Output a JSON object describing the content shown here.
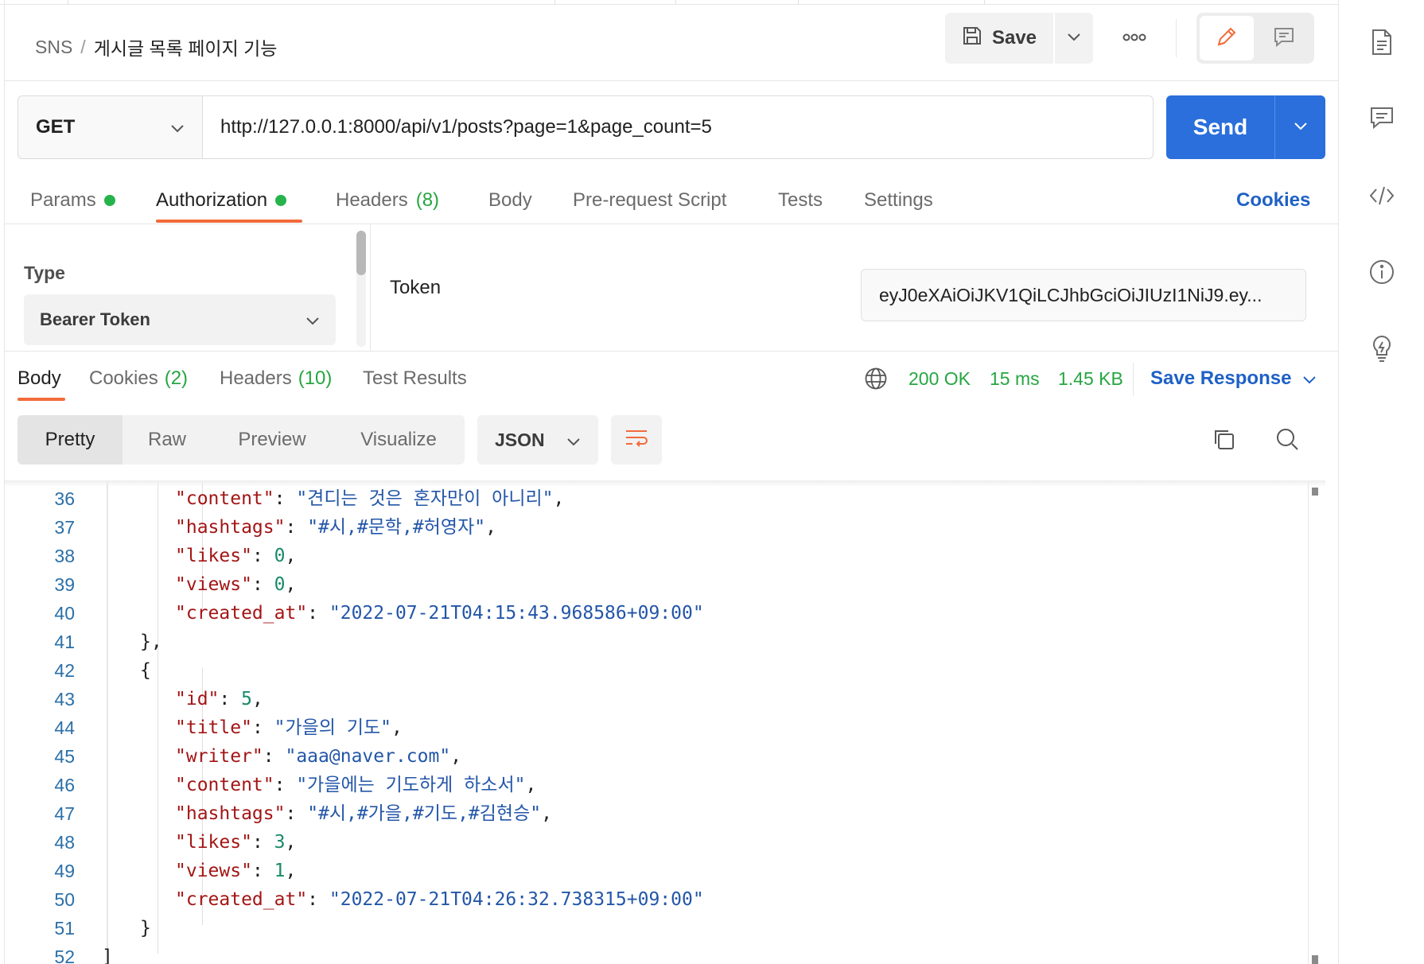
{
  "breadcrumb": {
    "root": "SNS",
    "separator": "/",
    "current": "게시글 목록 페이지 기능"
  },
  "header": {
    "save_label": "Save"
  },
  "request": {
    "method": "GET",
    "url": "http://127.0.0.1:8000/api/v1/posts?page=1&page_count=5",
    "send_label": "Send"
  },
  "request_tabs": {
    "params": "Params",
    "authorization": "Authorization",
    "headers": "Headers",
    "headers_count": "(8)",
    "body": "Body",
    "pre_request": "Pre-request Script",
    "tests": "Tests",
    "settings": "Settings",
    "cookies": "Cookies"
  },
  "auth": {
    "type_label": "Type",
    "type_value": "Bearer Token",
    "token_label": "Token",
    "token_value": "eyJ0eXAiOiJKV1QiLCJhbGciOiJIUzI1NiJ9.ey..."
  },
  "response_tabs": {
    "body": "Body",
    "cookies": "Cookies",
    "cookies_count": "(2)",
    "headers": "Headers",
    "headers_count": "(10)",
    "test_results": "Test Results"
  },
  "response_meta": {
    "status": "200 OK",
    "time": "15 ms",
    "size": "1.45 KB",
    "save_response": "Save Response"
  },
  "view_modes": {
    "pretty": "Pretty",
    "raw": "Raw",
    "preview": "Preview",
    "visualize": "Visualize"
  },
  "format": "JSON",
  "colors": {
    "accent": "#f26b3a",
    "send": "#2a6fdb",
    "link": "#1f61c6",
    "success": "#26a641"
  },
  "code_lines": [
    {
      "n": "36",
      "key": "\"content\"",
      "sep": ": ",
      "val": "\"견디는 것은 혼자만이 아니리\"",
      "vt": "str",
      "tail": ","
    },
    {
      "n": "37",
      "key": "\"hashtags\"",
      "sep": ": ",
      "val": "\"#시,#문학,#허영자\"",
      "vt": "str",
      "tail": ","
    },
    {
      "n": "38",
      "key": "\"likes\"",
      "sep": ": ",
      "val": "0",
      "vt": "num",
      "tail": ","
    },
    {
      "n": "39",
      "key": "\"views\"",
      "sep": ": ",
      "val": "0",
      "vt": "num",
      "tail": ","
    },
    {
      "n": "40",
      "key": "\"created_at\"",
      "sep": ": ",
      "val": "\"2022-07-21T04:15:43.968586+09:00\"",
      "vt": "str",
      "tail": ""
    },
    {
      "n": "41",
      "punct": "},",
      "lvl": 1
    },
    {
      "n": "42",
      "punct": "{",
      "lvl": 1
    },
    {
      "n": "43",
      "key": "\"id\"",
      "sep": ": ",
      "val": "5",
      "vt": "num",
      "tail": ","
    },
    {
      "n": "44",
      "key": "\"title\"",
      "sep": ": ",
      "val": "\"가을의 기도\"",
      "vt": "str",
      "tail": ","
    },
    {
      "n": "45",
      "key": "\"writer\"",
      "sep": ": ",
      "val": "\"aaa@naver.com\"",
      "vt": "str",
      "tail": ","
    },
    {
      "n": "46",
      "key": "\"content\"",
      "sep": ": ",
      "val": "\"가을에는 기도하게 하소서\"",
      "vt": "str",
      "tail": ","
    },
    {
      "n": "47",
      "key": "\"hashtags\"",
      "sep": ": ",
      "val": "\"#시,#가을,#기도,#김현승\"",
      "vt": "str",
      "tail": ","
    },
    {
      "n": "48",
      "key": "\"likes\"",
      "sep": ": ",
      "val": "3",
      "vt": "num",
      "tail": ","
    },
    {
      "n": "49",
      "key": "\"views\"",
      "sep": ": ",
      "val": "1",
      "vt": "num",
      "tail": ","
    },
    {
      "n": "50",
      "key": "\"created_at\"",
      "sep": ": ",
      "val": "\"2022-07-21T04:26:32.738315+09:00\"",
      "vt": "str",
      "tail": ""
    },
    {
      "n": "51",
      "punct": "}",
      "lvl": 1
    },
    {
      "n": "52",
      "punct": "]",
      "lvl": 0
    }
  ]
}
